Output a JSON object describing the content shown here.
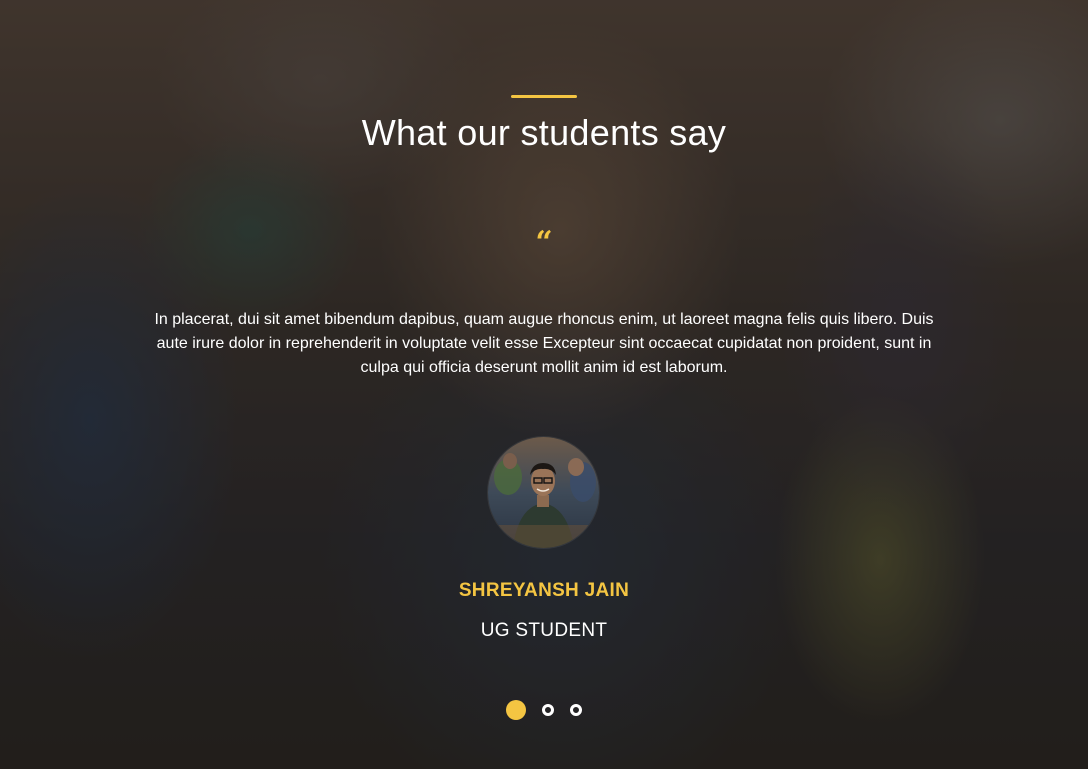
{
  "section": {
    "title": "What our students say",
    "quote_icon": "quote-icon",
    "accent_color": "#f4c542"
  },
  "testimonial": {
    "text": "In placerat, dui sit amet bibendum dapibus, quam augue rhoncus enim, ut laoreet magna felis quis libero. Duis aute irure dolor in reprehenderit in voluptate velit esse  Excepteur sint occaecat cupidatat non proident, sunt in culpa qui officia deserunt mollit anim id est laborum.",
    "quote_mark": "“",
    "author_name": "SHREYANSH JAIN",
    "author_role": "UG STUDENT",
    "avatar_icon": "student-avatar-photo"
  },
  "carousel": {
    "slide_count": 3,
    "active_index": 0
  }
}
